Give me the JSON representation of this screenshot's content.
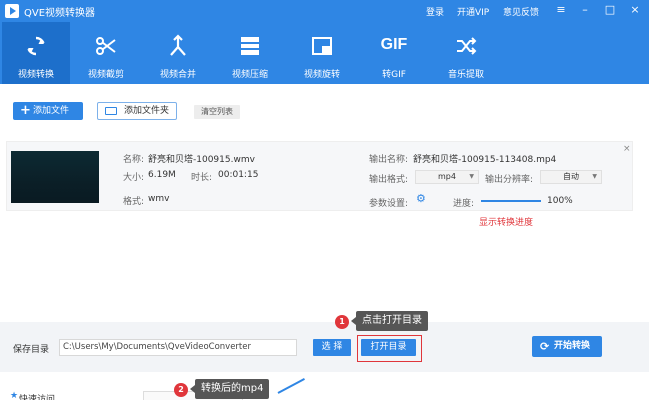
{
  "titlebar": {
    "title": "QVE视频转换器",
    "links": [
      "登录",
      "开通VIP",
      "意见反馈"
    ]
  },
  "toolbar": {
    "items": [
      {
        "label": "视频转换",
        "icon": "convert-icon",
        "active": true
      },
      {
        "label": "视频截剪",
        "icon": "scissors-icon",
        "active": false
      },
      {
        "label": "视频合并",
        "icon": "merge-icon",
        "active": false
      },
      {
        "label": "视频压缩",
        "icon": "compress-icon",
        "active": false
      },
      {
        "label": "视频旋转",
        "icon": "rotate-icon",
        "active": false
      },
      {
        "label": "转GIF",
        "icon": "gif-icon",
        "gif_text": "GIF",
        "active": false
      },
      {
        "label": "音乐提取",
        "icon": "shuffle-icon",
        "active": false
      }
    ]
  },
  "actions": {
    "add_file": "添加文件",
    "add_folder": "添加文件夹",
    "clear_list": "清空列表"
  },
  "file": {
    "name_label": "名称:",
    "name": "舒亮和贝塔-100915.wmv",
    "size_label": "大小:",
    "size": "6.19M",
    "duration_label": "时长:",
    "duration": "00:01:15",
    "format_label": "格式:",
    "format": "wmv",
    "out_name_label": "输出名称:",
    "out_name": "舒亮和贝塔-100915-113408.mp4",
    "out_format_label": "输出格式:",
    "out_format": "mp4",
    "out_res_label": "输出分辨率:",
    "out_res": "自动",
    "params_label": "参数设置:",
    "progress_label": "进度:",
    "progress_text": "100%",
    "progress_fraction": 1.0,
    "note": "显示转换进度"
  },
  "bottom": {
    "save_label": "保存目录",
    "path": "C:\\Users\\My\\Documents\\QveVideoConverter",
    "choose": "选 择",
    "open_dir": "打开目录",
    "start": "开始转换"
  },
  "annotations": [
    {
      "num": "1",
      "text": "点击打开目录"
    },
    {
      "num": "2",
      "text": "转换后的mp4"
    }
  ],
  "lower": {
    "label": "快速访问"
  },
  "colors": {
    "accent": "#2f86e4",
    "active_tab": "#1d6fcb",
    "highlight": "#e0363b"
  }
}
